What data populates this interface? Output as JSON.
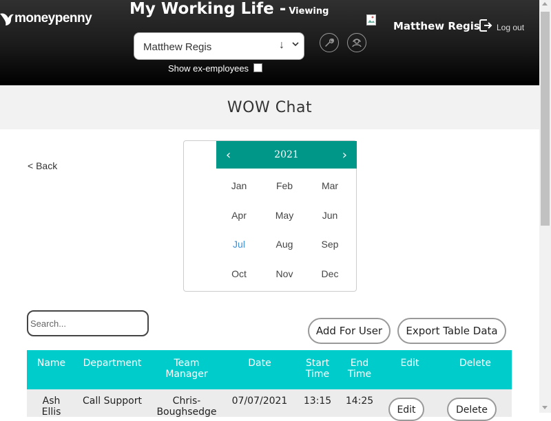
{
  "header": {
    "logo_text": "moneypenny",
    "title": "My Working Life -",
    "viewing_label": "Viewing",
    "employee_select_value": "Matthew Regis",
    "show_ex_employees_label": "Show ex-employees",
    "user_name": "Matthew Regis",
    "logout_label": "Log out",
    "icons": [
      "wrench-icon",
      "support-icon",
      "broken-image-icon",
      "logout-icon"
    ]
  },
  "page": {
    "title": "WOW Chat",
    "back_label": "< Back"
  },
  "calendar": {
    "year": "2021",
    "prev_symbol": "‹",
    "next_symbol": "›",
    "months": [
      "Jan",
      "Feb",
      "Mar",
      "Apr",
      "May",
      "Jun",
      "Jul",
      "Aug",
      "Sep",
      "Oct",
      "Nov",
      "Dec"
    ],
    "selected_month": "Jul"
  },
  "search": {
    "placeholder": "Search..."
  },
  "buttons": {
    "add_for_user": "Add For User",
    "export_table_data": "Export Table Data"
  },
  "table": {
    "headers": {
      "name": "Name",
      "department": "Department",
      "team_manager_l1": "Team",
      "team_manager_l2": "Manager",
      "date": "Date",
      "start_time_l1": "Start",
      "start_time_l2": "Time",
      "end_time_l1": "End",
      "end_time_l2": "Time",
      "edit": "Edit",
      "delete": "Delete"
    },
    "rows": [
      {
        "name_l1": "Ash",
        "name_l2": "Ellis",
        "department": "Call Support",
        "team_manager_l1": "Chris-",
        "team_manager_l2": "Boughsedge",
        "date": "07/07/2021",
        "start_time": "13:15",
        "end_time": "14:25",
        "edit_label": "Edit",
        "delete_label": "Delete"
      }
    ]
  },
  "colors": {
    "header_bg": "#1c1c1c",
    "calendar_accent": "#009688",
    "table_header": "#00cccc",
    "selected_month": "#3a8fd8"
  }
}
